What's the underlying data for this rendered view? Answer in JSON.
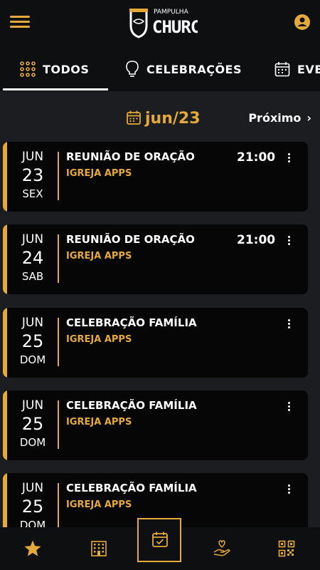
{
  "header": {
    "logo_top": "PAMPULHA",
    "logo_main": "CHURCH"
  },
  "tabs": [
    {
      "label": "TODOS",
      "icon": "grid-dots-icon",
      "active": true
    },
    {
      "label": "CELEBRAÇÕES",
      "icon": "lightbulb-icon",
      "active": false
    },
    {
      "label": "EVENTOS",
      "icon": "calendar-icon",
      "active": false
    }
  ],
  "month": {
    "label": "jun/23",
    "next_label": "Próximo"
  },
  "events": [
    {
      "mon": "JUN",
      "day": "23",
      "dow": "SEX",
      "title": "REUNIÃO DE ORAÇÃO",
      "subtitle": "IGREJA APPS",
      "time": "21:00"
    },
    {
      "mon": "JUN",
      "day": "24",
      "dow": "SAB",
      "title": "REUNIÃO DE ORAÇÃO",
      "subtitle": "IGREJA APPS",
      "time": "21:00"
    },
    {
      "mon": "JUN",
      "day": "25",
      "dow": "DOM",
      "title": "CELEBRAÇÃO FAMÍLIA",
      "subtitle": "IGREJA APPS",
      "time": ""
    },
    {
      "mon": "JUN",
      "day": "25",
      "dow": "DOM",
      "title": "CELEBRAÇÃO FAMÍLIA",
      "subtitle": "IGREJA APPS",
      "time": ""
    },
    {
      "mon": "JUN",
      "day": "25",
      "dow": "DOM",
      "title": "CELEBRAÇÃO FAMÍLIA",
      "subtitle": "IGREJA APPS",
      "time": ""
    }
  ],
  "bottom_nav": [
    {
      "icon": "star-icon",
      "active": false
    },
    {
      "icon": "building-icon",
      "active": false
    },
    {
      "icon": "calendar-check-icon",
      "active": true
    },
    {
      "icon": "hand-heart-icon",
      "active": false
    },
    {
      "icon": "qr-code-icon",
      "active": false
    }
  ],
  "colors": {
    "accent": "#e5a93a",
    "background": "#1b1d21",
    "bar": "#0e0f11",
    "card": "#060607"
  }
}
